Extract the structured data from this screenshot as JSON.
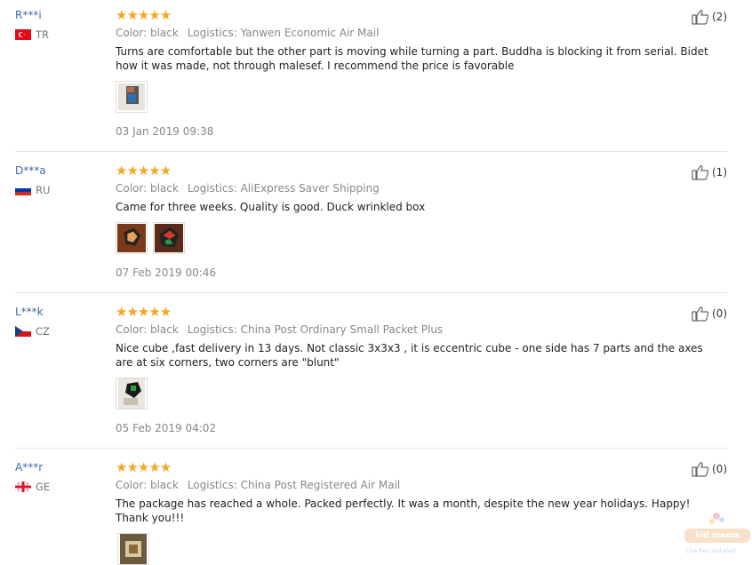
{
  "reviews": [
    {
      "user": "R***i",
      "country": "TR",
      "stars": "★★★★★",
      "color": "Color: black",
      "logistics": "Logistics: Yanwen Economic Air Mail",
      "text": "Turns are comfortable but the other part is moving while turning a part. Buddha is blocking it from serial. Bidet how it was made, not through malesef. I recommend the price is favorable",
      "date": "03 Jan 2019 09:38",
      "helpful": "(2)"
    },
    {
      "user": "D***a",
      "country": "RU",
      "stars": "★★★★★",
      "color": "Color: black",
      "logistics": "Logistics: AliExpress Saver Shipping",
      "text": "Came for three weeks. Quality is good. Duck wrinkled box",
      "date": "07 Feb 2019 00:46",
      "helpful": "(1)"
    },
    {
      "user": "L***k",
      "country": "CZ",
      "stars": "★★★★★",
      "color": "Color: black",
      "logistics": "Logistics: China Post Ordinary Small Packet Plus",
      "text": "Nice cube ,fast delivery in 13 days. Not classic 3x3x3 , it is eccentric cube - one side has 7 parts and the axes are at six corners, two corners are \"blunt\"",
      "date": "05 Feb 2019 04:02",
      "helpful": "(0)"
    },
    {
      "user": "A***r",
      "country": "GE",
      "stars": "★★★★★",
      "color": "Color: black",
      "logistics": "Logistics: China Post Registered Air Mail",
      "text": "The package has reached a whole. Packed perfectly. It was a month, despite the new year holidays. Happy! Thank you!!!",
      "date": "",
      "helpful": "(0)"
    }
  ],
  "watermark": {
    "main": "kid mama",
    "sub": "Live free and play!"
  },
  "colors": {
    "star": "#f5a623",
    "username": "#3e6aa8",
    "divider": "#e6e6e6"
  }
}
